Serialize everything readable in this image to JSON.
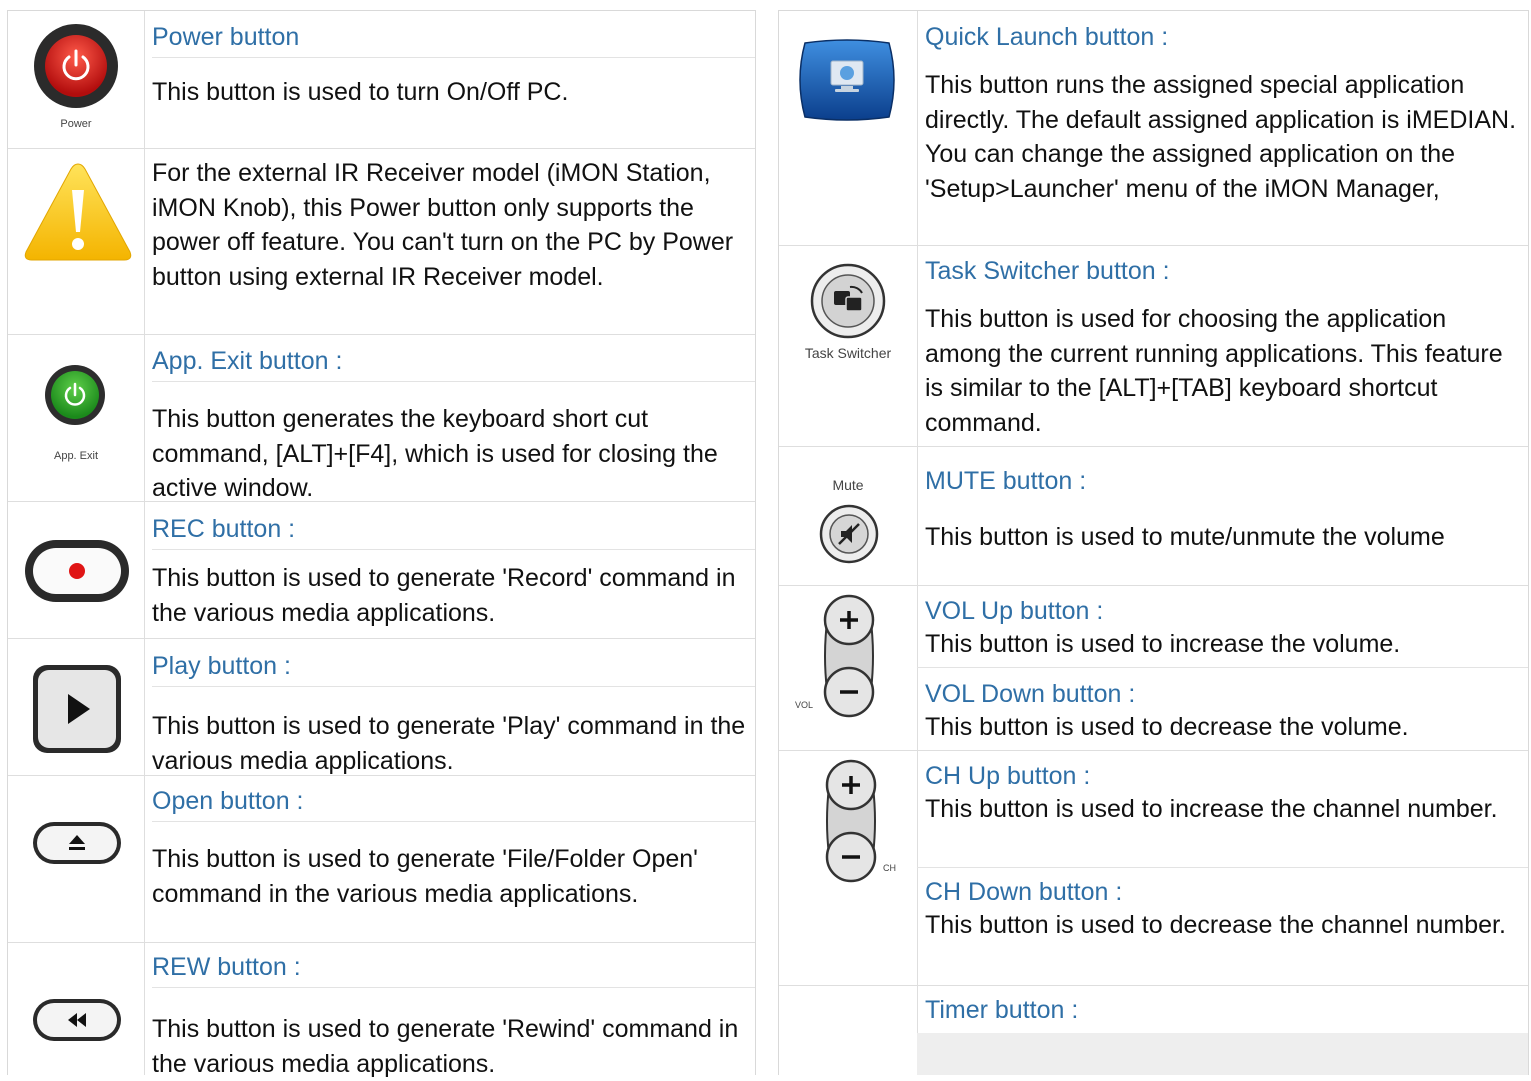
{
  "left": [
    {
      "title": "Power button",
      "desc": "This button is used to turn On/Off PC.",
      "icon": "power-icon",
      "caption": "Power"
    },
    {
      "title": "",
      "desc": "For the external IR Receiver model (iMON Station, iMON Knob), this Power button only supports the power off feature. You can't turn on the PC by Power button using external IR Receiver model.",
      "icon": "warning-icon"
    },
    {
      "title": "App. Exit button :",
      "desc": "This button generates the keyboard short cut command, [ALT]+[F4], which is used for closing the active window.",
      "icon": "app-exit-icon",
      "caption": "App. Exit"
    },
    {
      "title": "REC button :",
      "desc": "This button is used to generate 'Record' command in the various media applications.",
      "icon": "record-icon"
    },
    {
      "title": "Play button :",
      "desc": "This button is used to generate 'Play' command in the various media applications.",
      "icon": "play-icon"
    },
    {
      "title": "Open button :",
      "desc": "This button is used to generate 'File/Folder Open' command in the various media applications.",
      "icon": "eject-icon"
    },
    {
      "title": "REW button :",
      "desc": "This button is used to generate 'Rewind' command in the various media applications.",
      "icon": "rewind-icon"
    }
  ],
  "right": [
    {
      "title": "Quick Launch button :",
      "desc": "This button runs the assigned special application directly. The default assigned application is iMEDIAN. You can change the assigned application on the 'Setup>Launcher' menu of the iMON Manager,",
      "icon": "monitor-icon"
    },
    {
      "title": "Task Switcher button :",
      "desc": "This button is used for choosing the application among the current running applications. This feature is similar to the [ALT]+[TAB] keyboard shortcut command.",
      "icon": "task-switcher-icon",
      "caption": "Task Switcher"
    },
    {
      "title": "MUTE button :",
      "desc": "This button is used to mute/unmute the volume",
      "icon": "mute-icon",
      "caption": "Mute"
    },
    {
      "titles": [
        "VOL Up button :",
        "VOL Down button :"
      ],
      "descs": [
        "This button is used to increase the volume.",
        "This button is used to decrease the volume."
      ],
      "icon": "volume-rocker-icon",
      "caption": "VOL"
    },
    {
      "titles": [
        "CH Up button :",
        "CH Down button :"
      ],
      "descs": [
        "This button is used to increase the channel number.",
        "This button is used to decrease the channel number."
      ],
      "icon": "channel-rocker-icon",
      "caption": "CH"
    },
    {
      "title": "Timer button :",
      "desc": ""
    }
  ]
}
